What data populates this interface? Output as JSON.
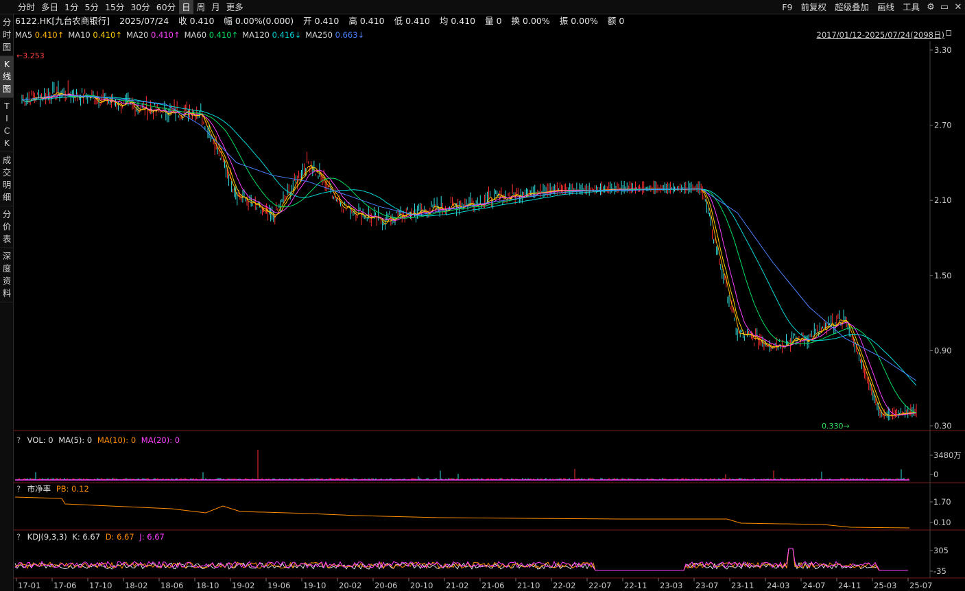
{
  "toolbar": {
    "periods": [
      "分时",
      "多日",
      "1分",
      "5分",
      "15分",
      "30分",
      "60分",
      "日",
      "周",
      "月",
      "更多"
    ],
    "active_period": "日",
    "right_items": [
      "F9",
      "前复权",
      "超级叠加",
      "画线",
      "工具"
    ],
    "right_icons": [
      "gear-icon",
      "window-icon",
      "close-icon"
    ]
  },
  "sidebar": {
    "items": [
      {
        "label": "分时图",
        "active": false
      },
      {
        "label": "K线图",
        "active": true
      },
      {
        "label": "TICK",
        "active": false
      },
      {
        "label": "成交明细",
        "active": false
      },
      {
        "label": "分价表",
        "active": false
      },
      {
        "label": "深度资料",
        "active": false
      }
    ]
  },
  "quote": {
    "symbol": "6122.HK[九台农商银行]",
    "date": "2025/07/24",
    "close": "收 0.410",
    "change": "幅 0.00%(0.000)",
    "open": "开 0.410",
    "high": "高 0.410",
    "low": "低 0.410",
    "avg": "均 0.410",
    "volume": "量 0",
    "turnover": "换 0.00%",
    "amplitude": "振 0.00%",
    "amount": "额 0"
  },
  "ma_legend": [
    {
      "label": "MA5",
      "value": "0.410↑",
      "color": "#ffb400"
    },
    {
      "label": "MA10",
      "value": "0.410↑",
      "color": "#ffd000"
    },
    {
      "label": "MA20",
      "value": "0.410↑",
      "color": "#ff40ff"
    },
    {
      "label": "MA60",
      "value": "0.410↑",
      "color": "#00e060"
    },
    {
      "label": "MA120",
      "value": "0.416↓",
      "color": "#00d8d8"
    },
    {
      "label": "MA250",
      "value": "0.663↓",
      "color": "#4a80ff"
    }
  ],
  "date_range": "2017/01/12-2025/07/24(2098日)",
  "price_axis": [
    "3.30",
    "2.70",
    "2.10",
    "1.50",
    "0.90",
    "0.30"
  ],
  "max_price_label": "3.253",
  "min_price_label": "0.330",
  "volume_panel": {
    "legend": [
      "VOL: 0",
      "MA(5): 0",
      "MA(10): 0",
      "MA(20): 0"
    ],
    "axis": [
      "3480万",
      "0"
    ]
  },
  "pb_panel": {
    "legend_name": "市净率",
    "legend_value": "PB: 0.12",
    "axis": [
      "1.70",
      "0.10"
    ]
  },
  "kdj_panel": {
    "legend": [
      "KDJ(9,3,3)",
      "K: 6.67",
      "D: 6.67",
      "J: 6.67"
    ],
    "axis": [
      "305",
      "-35"
    ]
  },
  "time_axis": [
    "17-01",
    "17-06",
    "17-10",
    "18-02",
    "18-06",
    "18-10",
    "19-02",
    "19-06",
    "19-10",
    "20-02",
    "20-06",
    "20-10",
    "21-02",
    "21-06",
    "21-10",
    "22-02",
    "22-07",
    "22-11",
    "23-03",
    "23-07",
    "23-11",
    "24-03",
    "24-07",
    "24-11",
    "25-03",
    "25-07"
  ],
  "chart_data": {
    "type": "line",
    "series": [
      {
        "name": "MA5",
        "color": "#ffb400"
      },
      {
        "name": "MA10",
        "color": "#ffd000"
      },
      {
        "name": "MA20",
        "color": "#ff40ff"
      },
      {
        "name": "MA60",
        "color": "#00e060"
      },
      {
        "name": "MA120",
        "color": "#00d8d8"
      },
      {
        "name": "MA250",
        "color": "#4a80ff"
      }
    ],
    "x": [
      "17-01",
      "17-06",
      "17-10",
      "18-02",
      "18-06",
      "18-10",
      "19-02",
      "19-06",
      "19-10",
      "20-02",
      "20-06",
      "20-10",
      "21-02",
      "21-06",
      "21-10",
      "22-02",
      "22-07",
      "22-11",
      "23-03",
      "23-07",
      "23-11",
      "24-03",
      "24-07",
      "24-11",
      "25-03",
      "25-07"
    ],
    "close_approx": [
      2.9,
      2.95,
      2.92,
      2.85,
      2.8,
      2.8,
      2.15,
      1.95,
      2.4,
      2.05,
      1.93,
      2.0,
      2.05,
      2.1,
      2.15,
      2.18,
      2.18,
      2.19,
      2.19,
      2.19,
      1.03,
      0.95,
      1.0,
      1.15,
      0.38,
      0.41
    ],
    "ma250_approx": [
      2.9,
      2.94,
      2.93,
      2.9,
      2.87,
      2.7,
      2.4,
      2.3,
      2.25,
      2.15,
      2.05,
      1.98,
      2.03,
      2.08,
      2.12,
      2.16,
      2.18,
      2.18,
      2.19,
      2.19,
      2.0,
      1.6,
      1.25,
      1.0,
      0.85,
      0.66
    ],
    "ylim": [
      0.3,
      3.3
    ],
    "grid": false
  }
}
